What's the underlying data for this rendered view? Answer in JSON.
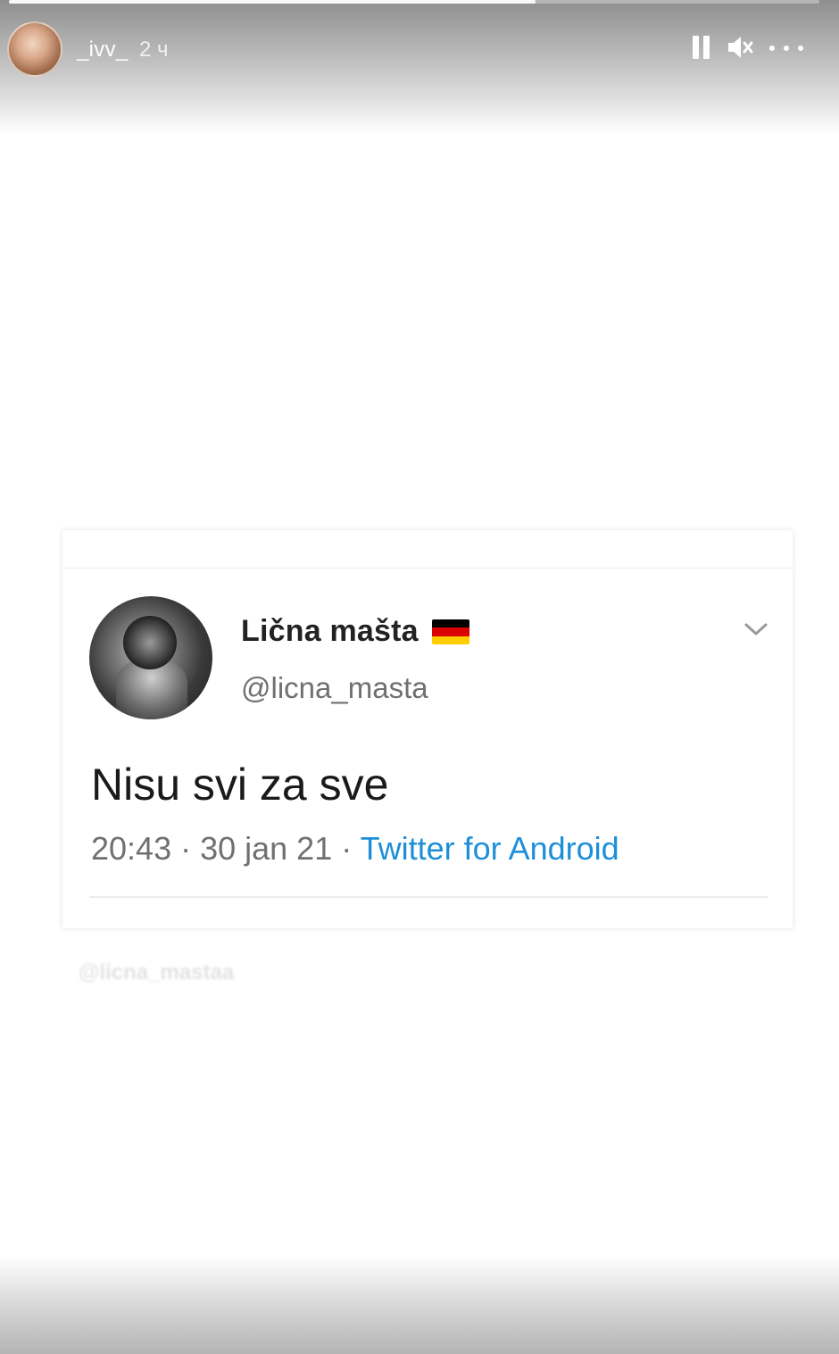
{
  "story": {
    "username": "_ivv_",
    "time_ago": "2 ч",
    "progress": 0.65,
    "controls": {
      "pause": "pause-icon",
      "mute": "speaker-muted-icon",
      "more": "more-horizontal-icon"
    }
  },
  "tweet": {
    "display_name": "Lična mašta",
    "flag": "german-flag-icon",
    "flag_colors": [
      "#000000",
      "#dd0000",
      "#ffce00"
    ],
    "handle": "@licna_masta",
    "text": "Nisu svi za sve",
    "time": "20:43",
    "date": "30 jan 21",
    "separator": " · ",
    "source": "Twitter for Android",
    "source_color": "#1d8fd8"
  },
  "watermark": "@licna_mastaa"
}
